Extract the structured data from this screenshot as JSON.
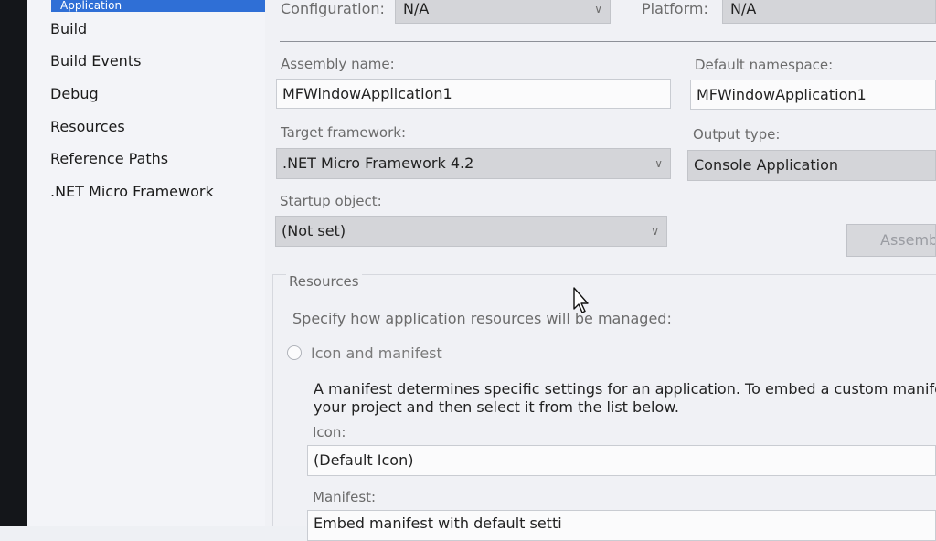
{
  "sidebar": {
    "active_tab": "Application",
    "items": [
      {
        "label": "Build"
      },
      {
        "label": "Build Events"
      },
      {
        "label": "Debug"
      },
      {
        "label": "Resources"
      },
      {
        "label": "Reference Paths"
      },
      {
        "label": ".NET Micro Framework"
      }
    ]
  },
  "header": {
    "configuration_label": "Configuration:",
    "configuration_value": "N/A",
    "platform_label": "Platform:",
    "platform_value": "N/A"
  },
  "form": {
    "assembly_name_label": "Assembly name:",
    "assembly_name_value": "MFWindowApplication1",
    "default_namespace_label": "Default namespace:",
    "default_namespace_value": "MFWindowApplication1",
    "target_framework_label": "Target framework:",
    "target_framework_value": ".NET Micro Framework 4.2",
    "output_type_label": "Output type:",
    "output_type_value": "Console Application",
    "startup_object_label": "Startup object:",
    "startup_object_value": "(Not set)",
    "assembly_info_button": "Assemb"
  },
  "resources": {
    "group_title": "Resources",
    "description": "Specify how application resources will be managed:",
    "icon_manifest_option": "Icon and manifest",
    "manifest_info_line1": "A manifest determines specific settings for an application. To embed a custom manifest",
    "manifest_info_line2": "your project and then select it from the list below.",
    "icon_label": "Icon:",
    "icon_value": "(Default Icon)",
    "manifest_label": "Manifest:",
    "manifest_value": "Embed manifest with default setti"
  },
  "icons": {
    "dropdown": "chevron-down-icon",
    "cursor": "mouse-pointer-icon"
  }
}
